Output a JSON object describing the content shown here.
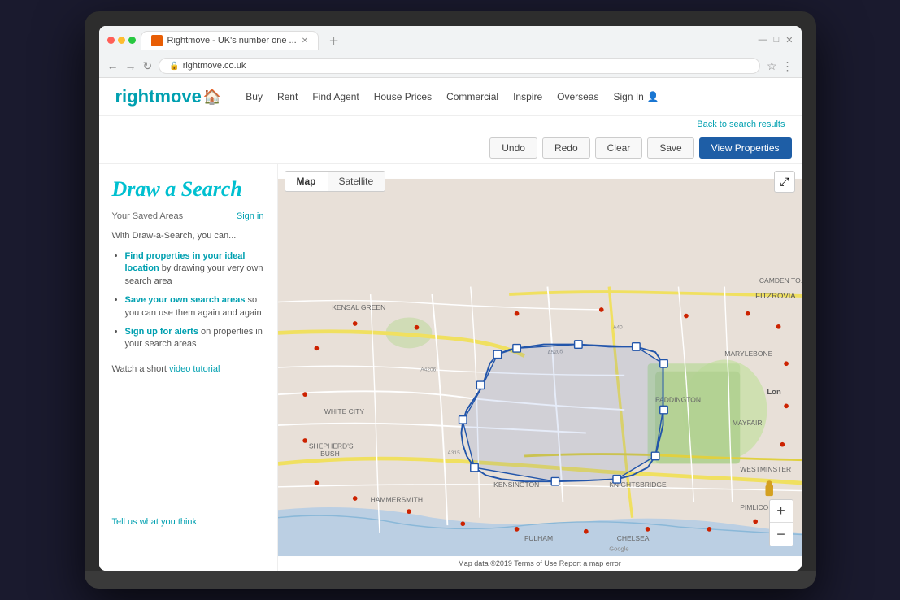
{
  "browser": {
    "tab_title": "Rightmove - UK's number one ...",
    "address": "rightmove.co.uk",
    "tab_favicon": "R"
  },
  "nav": {
    "logo": "rightmove",
    "links": [
      "Buy",
      "Rent",
      "Find Agent",
      "House Prices",
      "Commercial",
      "Inspire",
      "Overseas",
      "Sign In"
    ],
    "back_link": "Back to search results"
  },
  "sidebar": {
    "title": "Draw a Search",
    "saved_areas_label": "Your Saved Areas",
    "sign_in_label": "Sign in",
    "description": "With Draw-a-Search, you can...",
    "features": [
      {
        "highlight": "Find properties in your ideal location",
        "rest": " by drawing your very own search area"
      },
      {
        "highlight": "Save your own search areas",
        "rest": " so you can use them again and again"
      },
      {
        "highlight": "Sign up for alerts",
        "rest": " on properties in your search areas"
      }
    ],
    "video_link_text": "Watch a short ",
    "video_link_anchor": "video tutorial",
    "footer_link": "Tell us what you think"
  },
  "toolbar": {
    "undo_label": "Undo",
    "redo_label": "Redo",
    "clear_label": "Clear",
    "save_label": "Save",
    "view_properties_label": "View Properties"
  },
  "map": {
    "tab_map": "Map",
    "tab_satellite": "Satellite",
    "attribution": "Map data ©2019  Terms of Use  Report a map error",
    "zoom_in": "+",
    "zoom_out": "−",
    "fullscreen": "⤢"
  }
}
